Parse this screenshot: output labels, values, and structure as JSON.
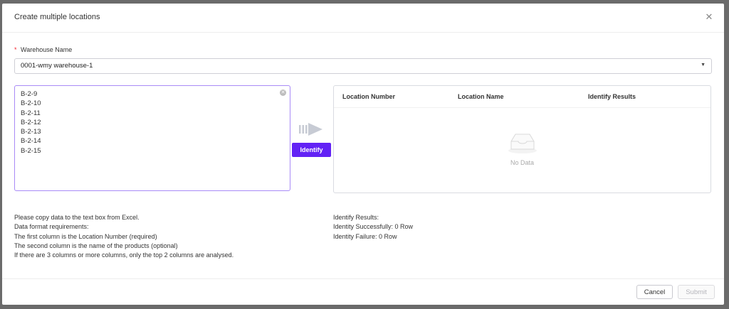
{
  "dialog": {
    "title": "Create multiple locations",
    "close_icon": "close-icon"
  },
  "warehouse": {
    "required_mark": "*",
    "label": "Warehouse Name",
    "value": "0001-wmy warehouse-1"
  },
  "input_lines": [
    "B-2-9",
    "B-2-10",
    "B-2-11",
    "B-2-12",
    "B-2-13",
    "B-2-14",
    "B-2-15"
  ],
  "identify": {
    "label": "Identify"
  },
  "results_table": {
    "columns": [
      "Location Number",
      "Location Name",
      "Identify Results"
    ],
    "empty_text": "No Data"
  },
  "help": {
    "lines": [
      "Please copy data to the text box from Excel.",
      "Data format requirements:",
      "The first column is the Location Number (required)",
      "The second column is the name of the products (optional)",
      "If there are 3 columns or more columns, only the top 2 columns are analysed."
    ]
  },
  "results_summary": {
    "title": "Identify Results:",
    "success": "Identity Successfully: 0 Row",
    "failure": "Identity Failure: 0 Row"
  },
  "footer": {
    "cancel_label": "Cancel",
    "submit_label": "Submit"
  },
  "colors": {
    "accent": "#6222f5",
    "focus_border": "#a98bf7",
    "required": "#f5222d"
  }
}
